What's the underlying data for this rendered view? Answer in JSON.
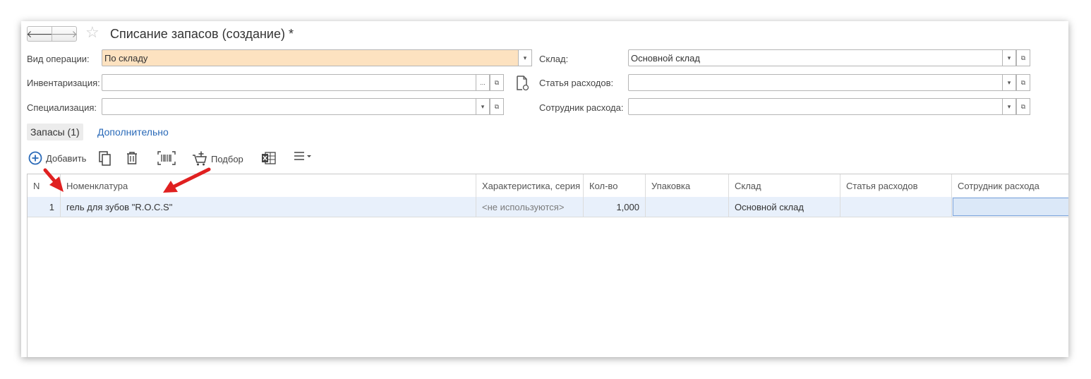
{
  "window": {
    "title": "Списание запасов (создание) *"
  },
  "form": {
    "operation_type": {
      "label": "Вид операции:",
      "value": "По складу"
    },
    "inventory": {
      "label": "Инвентаризация:",
      "value": ""
    },
    "specialization": {
      "label": "Специализация:",
      "value": ""
    },
    "warehouse": {
      "label": "Склад:",
      "value": "Основной склад"
    },
    "expense_item": {
      "label": "Статья расходов:",
      "value": ""
    },
    "expense_employee": {
      "label": "Сотрудник расхода:",
      "value": ""
    }
  },
  "tabs": [
    {
      "label": "Запасы (1)",
      "active": true
    },
    {
      "label": "Дополнительно",
      "active": false
    }
  ],
  "toolbar": {
    "add_label": "Добавить",
    "pick_label": "Подбор"
  },
  "table": {
    "columns": [
      "N",
      "Номенклатура",
      "Характеристика, серия",
      "Кол-во",
      "Упаковка",
      "Склад",
      "Статья расходов",
      "Сотрудник расхода"
    ],
    "rows": [
      {
        "n": "1",
        "nomenclature": "гель для зубов \"R.O.C.S\"",
        "characteristic": "<не используются>",
        "qty": "1,000",
        "package": "",
        "warehouse": "Основной склад",
        "expense_item": "",
        "employee": ""
      }
    ]
  },
  "colors": {
    "accent": "#2a6ab8",
    "field_highlight": "#fde2c0",
    "row_selected": "#e8f0fb",
    "annotation_arrow": "#e02020"
  }
}
